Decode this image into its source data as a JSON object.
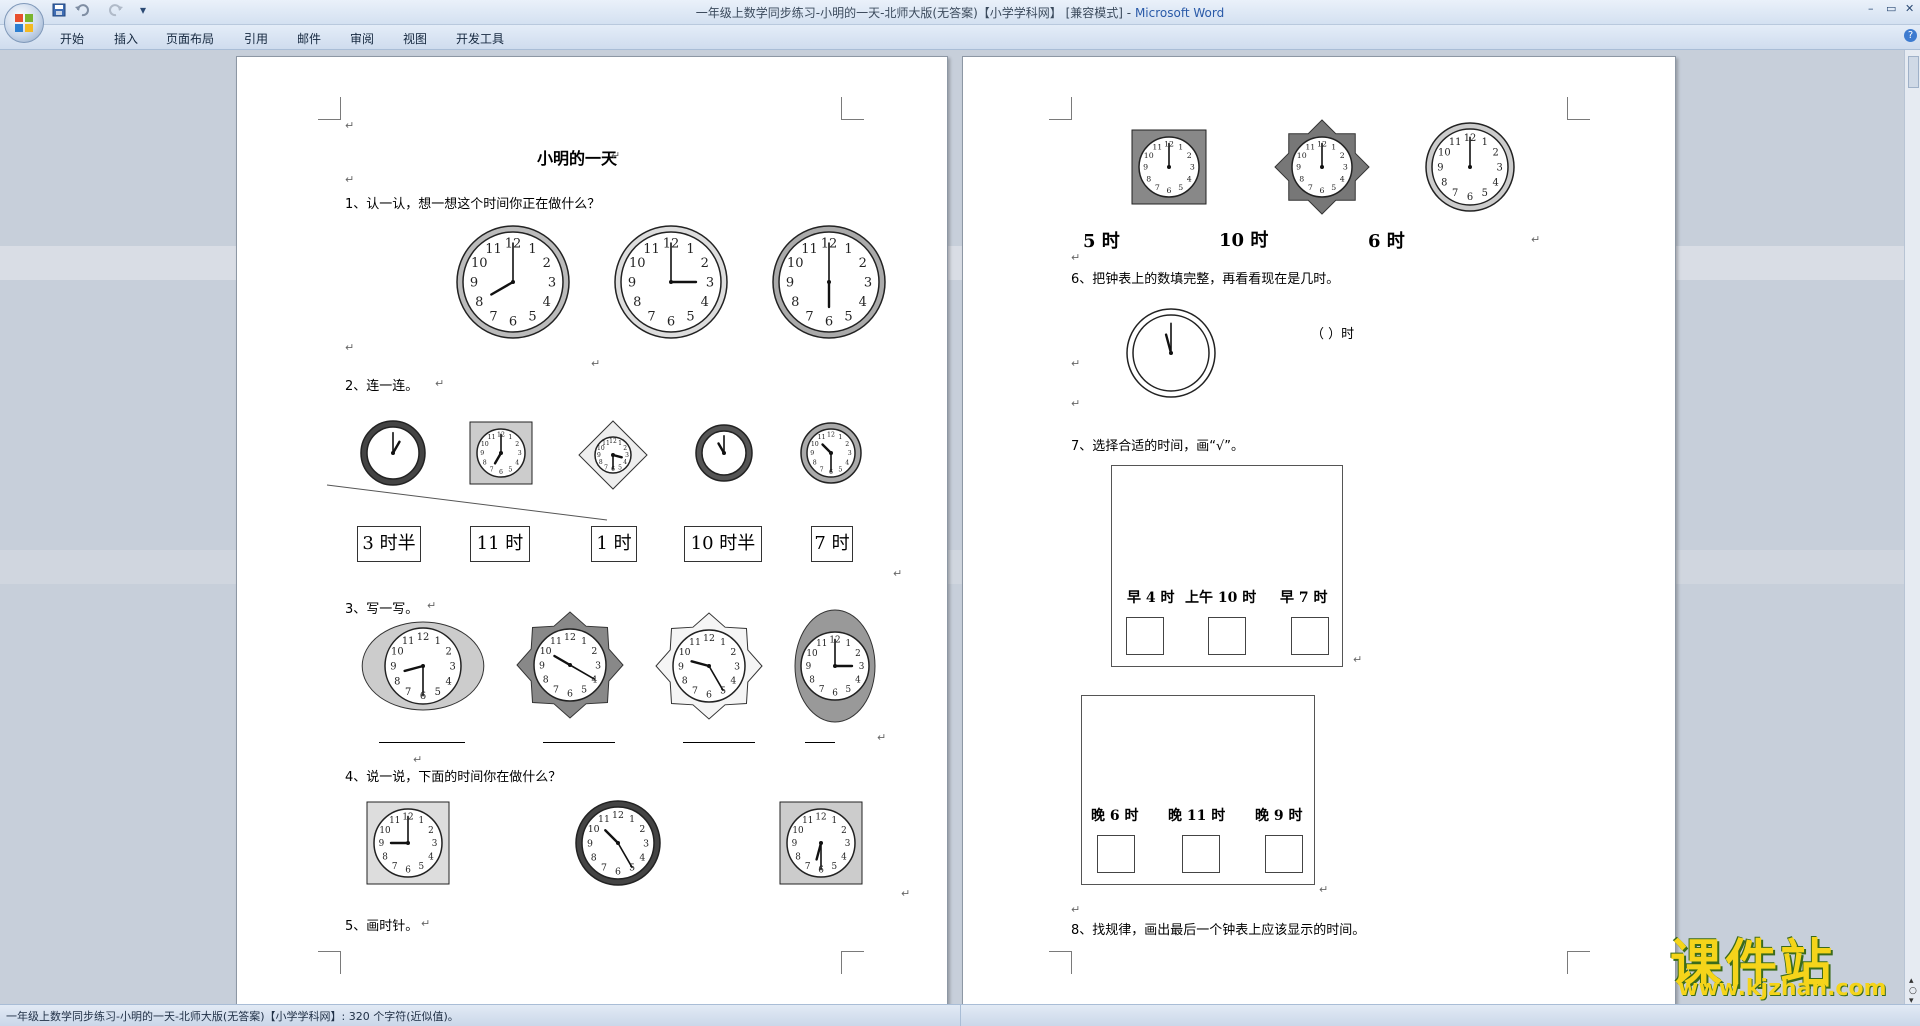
{
  "window": {
    "title_doc": "一年级上数学同步练习-小明的一天-北师大版(无答案)【小学学科网】 [兼容模式] - ",
    "title_app": "Microsoft Word",
    "minimize": "–",
    "restore": "▭",
    "close": "✕",
    "help": "?"
  },
  "quick_access": {
    "save_icon": "save-icon",
    "undo_icon": "undo-icon",
    "redo_icon": "redo-icon",
    "customize": "▾"
  },
  "ribbon": {
    "tabs": [
      "开始",
      "插入",
      "页面布局",
      "引用",
      "邮件",
      "审阅",
      "视图",
      "开发工具"
    ]
  },
  "status": {
    "text": "一年级上数学同步练习-小明的一天-北师大版(无答案)【小学学科网】: 320 个字符(近似值)。"
  },
  "doc": {
    "title": "小明的一天",
    "q1": "1、认一认，想一想这个时间你正在做什么？",
    "q2": "2、连一连。",
    "q2_labels": [
      "3 时半",
      "11 时",
      "1 时",
      "10 时半",
      "7 时"
    ],
    "q3": "3、写一写。",
    "q4": "4、说一说，下面的时间你在做什么？",
    "q5": "5、画时针。",
    "q5_labels": [
      "5 时",
      "10 时",
      "6 时"
    ],
    "q6": "6、把钟表上的数填完整，再看看现在是几时。",
    "q6_blank": "（      ）时",
    "q7": "7、选择合适的时间，画“√”。",
    "q7_morning": [
      "早 4 时",
      "上午 10 时",
      "早 7 时"
    ],
    "q7_evening": [
      "晚 6 时",
      "晚 11 时",
      "晚 9 时"
    ],
    "q8": "8、找规律，画出最后一个钟表上应该显示的时间。",
    "para_mark": "↵",
    "dial": [
      "12",
      "1",
      "2",
      "3",
      "4",
      "5",
      "6",
      "7",
      "8",
      "9",
      "10",
      "11"
    ]
  },
  "watermark": {
    "cn": "课件站",
    "url": "www.kjzhan.com"
  }
}
